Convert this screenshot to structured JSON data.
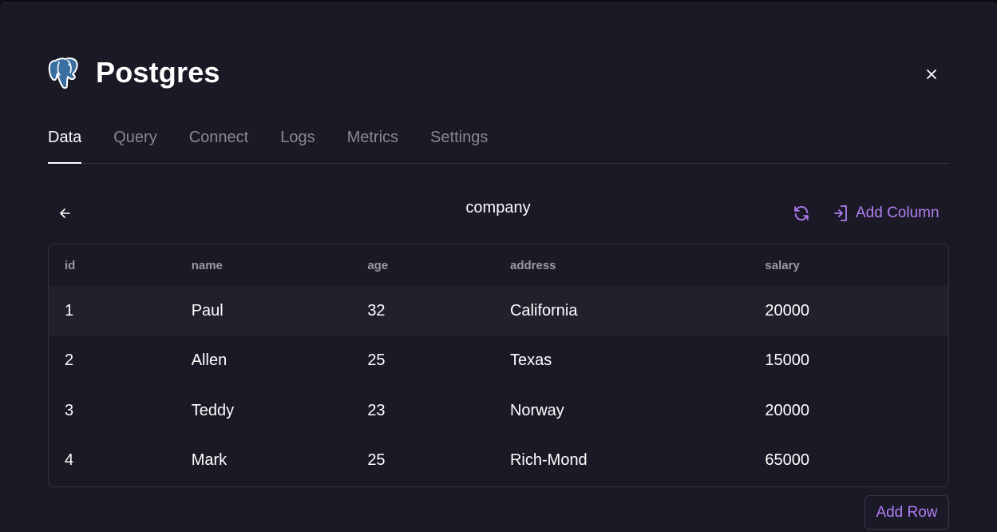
{
  "app": {
    "title": "Postgres"
  },
  "tabs": [
    {
      "label": "Data",
      "active": true
    },
    {
      "label": "Query",
      "active": false
    },
    {
      "label": "Connect",
      "active": false
    },
    {
      "label": "Logs",
      "active": false
    },
    {
      "label": "Metrics",
      "active": false
    },
    {
      "label": "Settings",
      "active": false
    }
  ],
  "toolbar": {
    "table_name": "company",
    "add_column_label": "Add Column"
  },
  "table": {
    "columns": [
      "id",
      "name",
      "age",
      "address",
      "salary"
    ],
    "rows": [
      [
        "1",
        "Paul",
        "32",
        "California",
        "20000"
      ],
      [
        "2",
        "Allen",
        "25",
        "Texas",
        "15000"
      ],
      [
        "3",
        "Teddy",
        "23",
        "Norway",
        "20000"
      ],
      [
        "4",
        "Mark",
        "25",
        "Rich-Mond",
        "65000"
      ]
    ],
    "highlighted_row": 0
  },
  "footer": {
    "add_row_label": "Add Row"
  },
  "colors": {
    "accent": "#b07ef2",
    "background": "#1b1926",
    "highlight_row": "#22202c",
    "border": "#33313f"
  },
  "icons": {
    "logo": "postgres-elephant-icon",
    "close": "close-icon",
    "back": "arrow-left-icon",
    "refresh": "refresh-icon",
    "add_column": "add-column-icon"
  }
}
